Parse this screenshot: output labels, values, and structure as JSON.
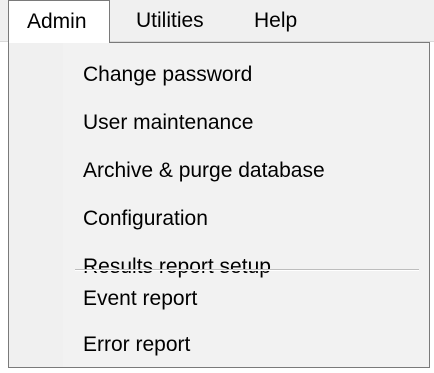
{
  "menubar": {
    "items": [
      {
        "label": "Admin"
      },
      {
        "label": "Utilities"
      },
      {
        "label": "Help"
      }
    ]
  },
  "admin_menu": {
    "items": [
      {
        "label": "Change password"
      },
      {
        "label": "User maintenance"
      },
      {
        "label": "Archive & purge database"
      },
      {
        "label": "Configuration"
      },
      {
        "label": "Results report setup"
      },
      {
        "label": "Event report"
      },
      {
        "label": "Error report"
      }
    ]
  }
}
